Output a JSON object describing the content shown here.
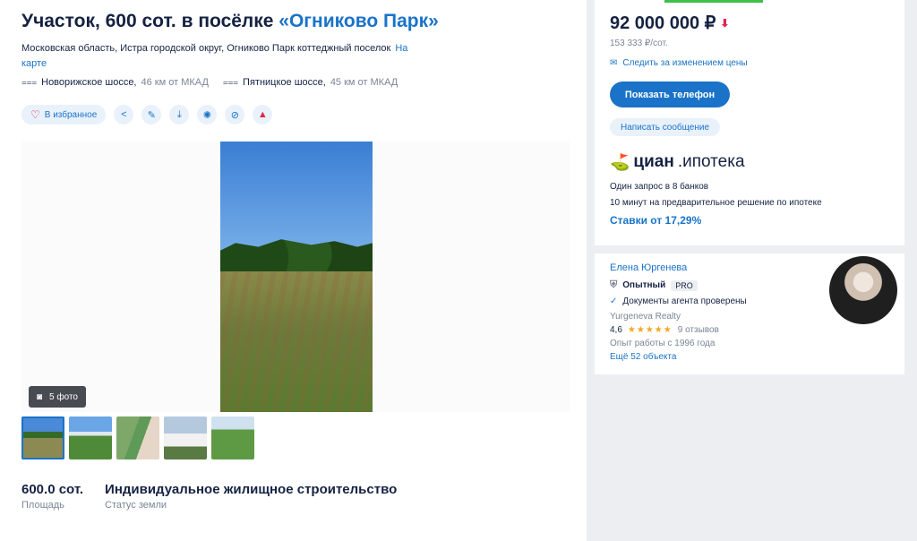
{
  "listing": {
    "title_prefix": "Участок, 600 сот. в посёлке ",
    "title_village": "«Огниково Парк»",
    "address": "Московская область, Истра городской округ, Огниково Парк коттеджный поселок",
    "map_link": "На карте",
    "highways": [
      {
        "name": "Новорижское шоссе,",
        "distance": "46 км от МКАД"
      },
      {
        "name": "Пятницкое шоссе,",
        "distance": "45 км от МКАД"
      }
    ],
    "favorite_label": "В избранное",
    "photo_count": "5 фото",
    "facts": [
      {
        "value": "600.0 сот.",
        "label": "Площадь"
      },
      {
        "value": "Индивидуальное жилищное строительство",
        "label": "Статус земли"
      }
    ]
  },
  "price": {
    "value": "92 000 000 ₽",
    "per_sotka": "153 333 ₽/сот.",
    "follow": "Следить за изменением цены",
    "phone_button": "Показать телефон",
    "message_button": "Написать сообщение"
  },
  "mortgage": {
    "brand": "циан",
    "product": ".ипотека",
    "line1": "Один запрос в 8 банков",
    "line2": "10 минут на предварительное решение по ипотеке",
    "rate": "Ставки от 17,29%"
  },
  "agent": {
    "name": "Елена Юргенева",
    "level": "Опытный",
    "pro": "PRO",
    "docs": "Документы агента проверены",
    "company": "Yurgeneva Realty",
    "rating": "4,6",
    "stars": "★★★★★",
    "reviews": "9 отзывов",
    "experience": "Опыт работы с 1996 года",
    "more_objects": "Ещё 52 объекта"
  },
  "colors": {
    "accent": "#1a73c8",
    "danger": "#e0264f",
    "text": "#152242",
    "muted": "#7a8596",
    "green_strip": "#3ec04b"
  }
}
